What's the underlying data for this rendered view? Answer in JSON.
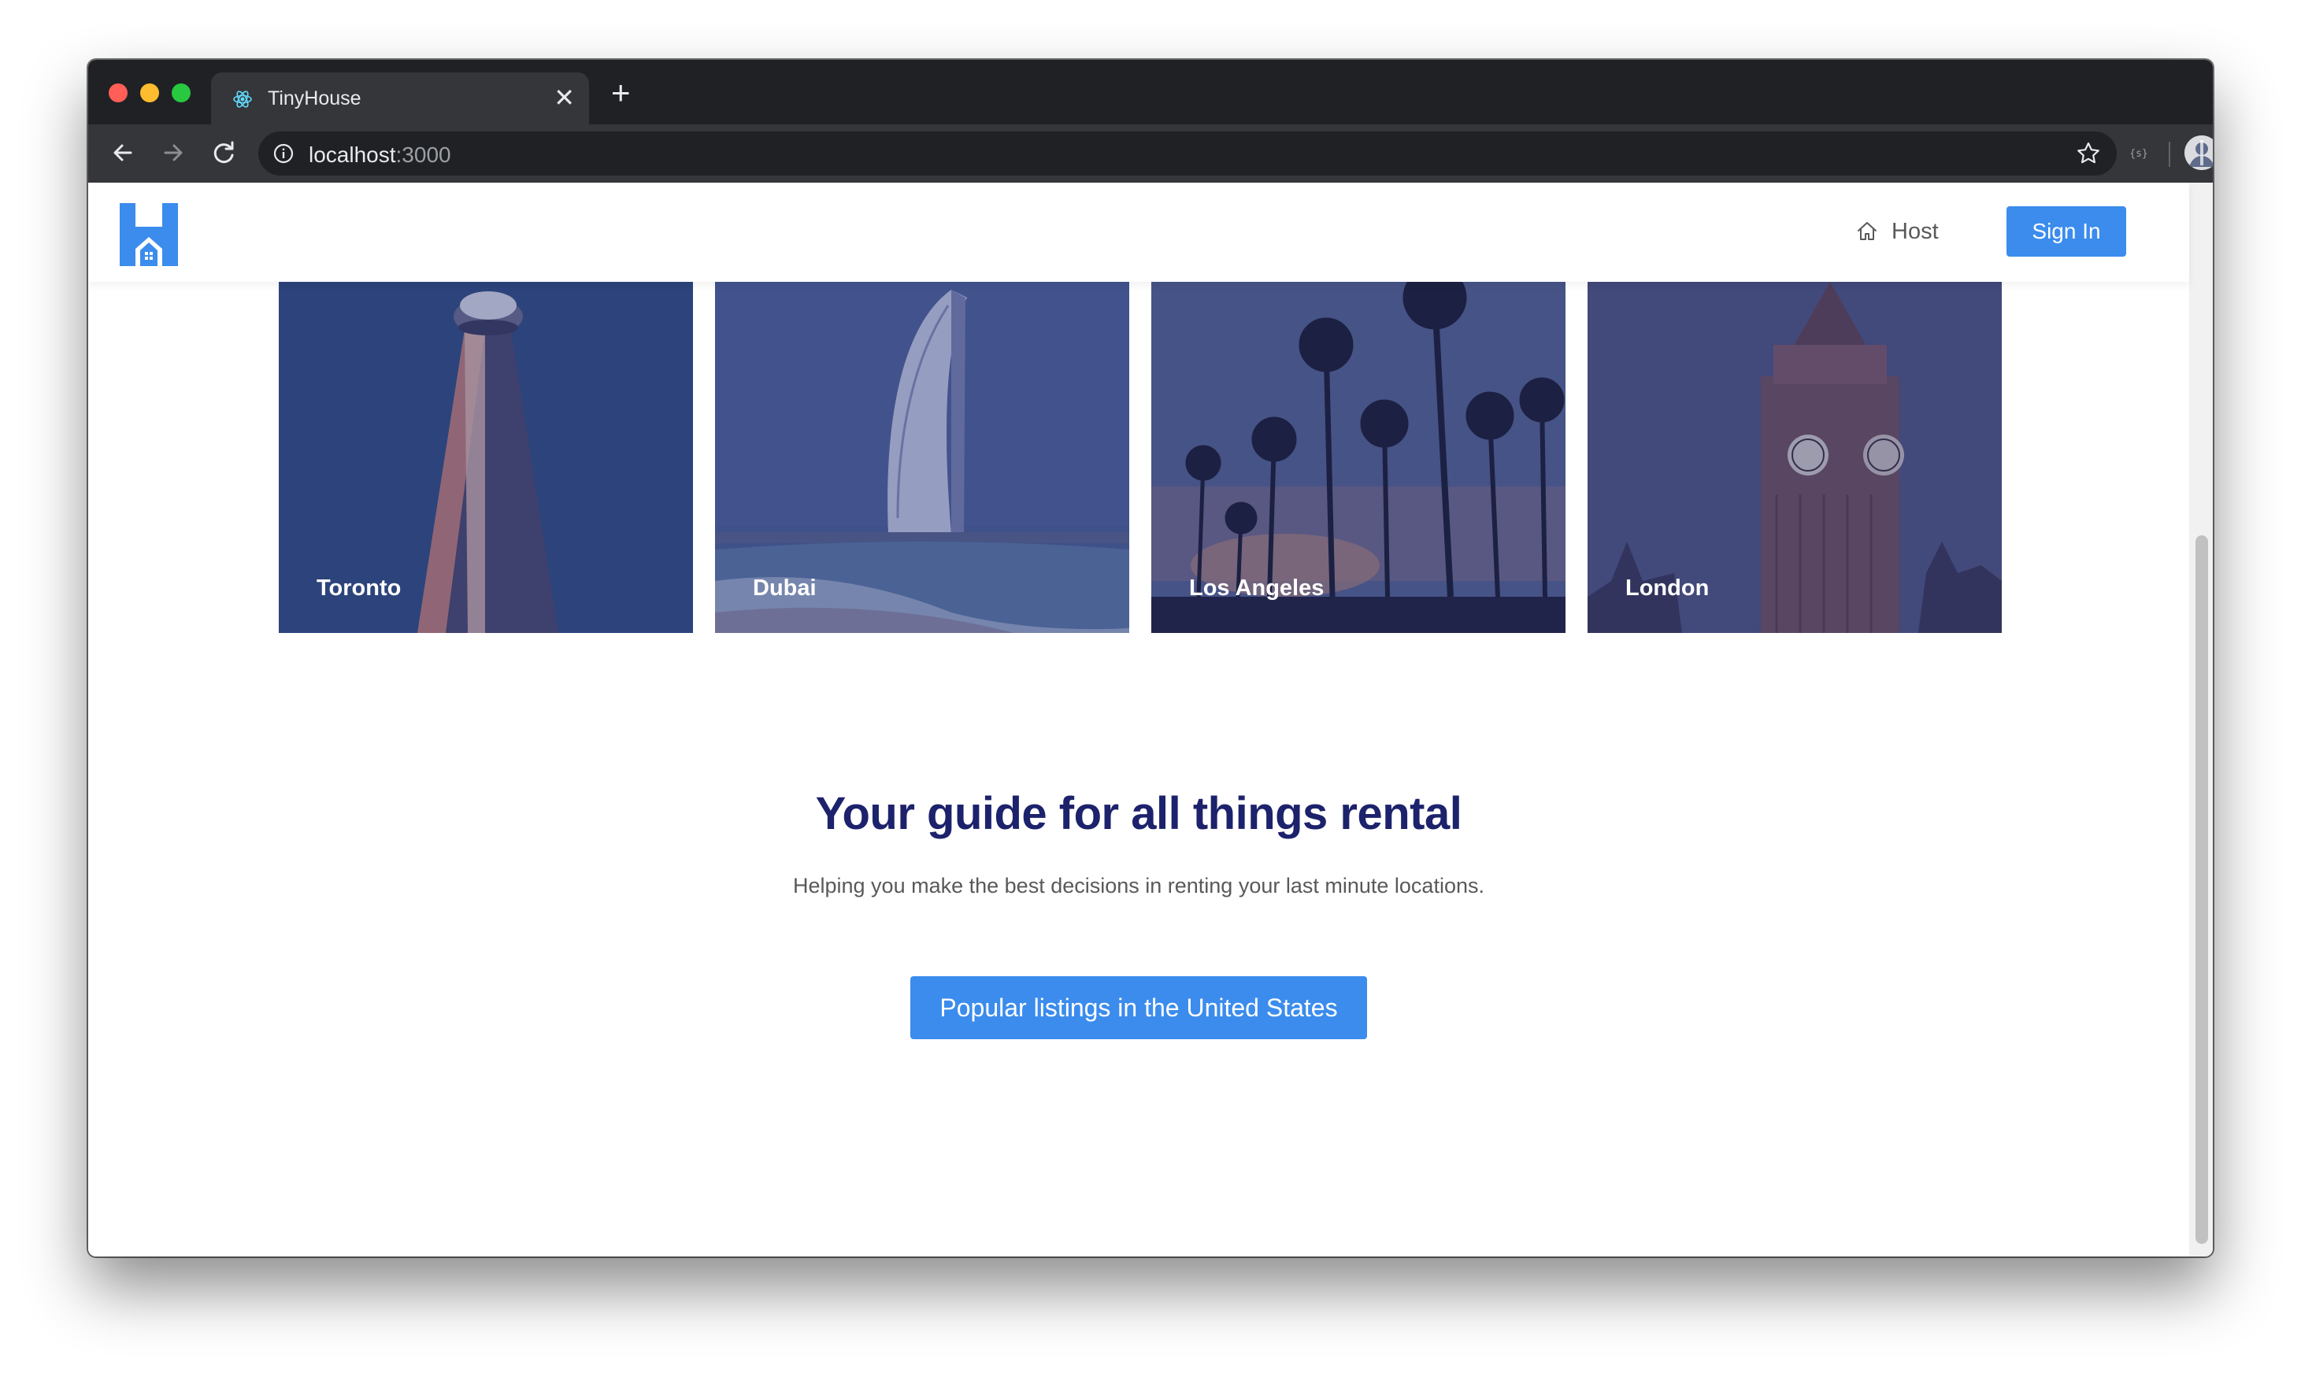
{
  "browser": {
    "tab_title": "TinyHouse",
    "url_host": "localhost",
    "url_port": ":3000"
  },
  "header": {
    "host_label": "Host",
    "signin_label": "Sign In"
  },
  "cities": [
    {
      "name": "Toronto"
    },
    {
      "name": "Dubai"
    },
    {
      "name": "Los Angeles"
    },
    {
      "name": "London"
    }
  ],
  "hero": {
    "title": "Your guide for all things rental",
    "subtitle": "Helping you make the best decisions in renting your last minute locations.",
    "cta_label": "Popular listings in the United States"
  },
  "colors": {
    "brand_blue": "#3b8ced",
    "title_navy": "#1d226c",
    "card_overlay": "#1d226c"
  }
}
